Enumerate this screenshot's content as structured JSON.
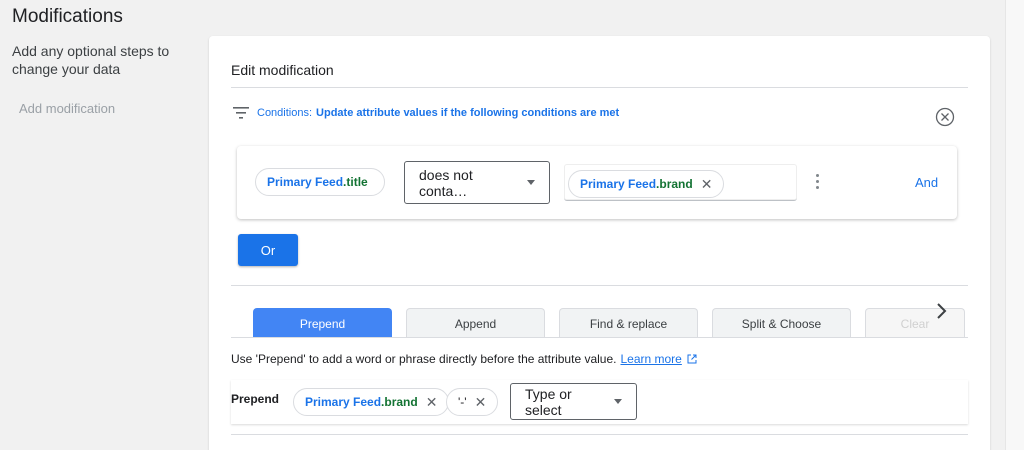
{
  "sidebar": {
    "title": "Modifications",
    "description": "Add any optional steps to change your data",
    "add_modification": "Add modification"
  },
  "editor": {
    "title": "Edit modification",
    "conditions": {
      "label": "Conditions:",
      "text": "Update attribute values if the following conditions are met",
      "icon": "filter-icon",
      "close_icon": "close-circle-icon"
    },
    "condition_row": {
      "attribute": {
        "source": "Primary Feed",
        "field": ".title"
      },
      "operator": "does not conta…",
      "value_chip": {
        "source": "Primary Feed",
        "field": ".brand"
      },
      "and_label": "And"
    },
    "or_label": "Or",
    "tabs": [
      {
        "label": "Prepend",
        "active": true
      },
      {
        "label": "Append",
        "active": false
      },
      {
        "label": "Find & replace",
        "active": false
      },
      {
        "label": "Split & Choose",
        "active": false
      },
      {
        "label": "Clear",
        "active": false
      }
    ],
    "help_text": "Use 'Prepend' to add a word or phrase directly before the attribute value.",
    "learn_more": "Learn more",
    "prepend": {
      "label": "Prepend",
      "chips": [
        {
          "source": "Primary Feed",
          "field": ".brand"
        },
        {
          "text": "'-'"
        }
      ],
      "select_placeholder": "Type or select"
    }
  },
  "colors": {
    "accent": "#1a73e8",
    "active_tab": "#4285f4",
    "attribute_green": "#137333"
  }
}
